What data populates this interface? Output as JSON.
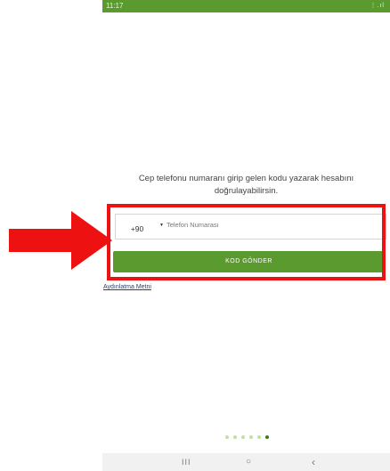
{
  "status_bar": {
    "time": "11:17",
    "icons": "⋮.ıl"
  },
  "instruction_text": "Cep telefonu numaranı girip gelen kodu yazarak hesabını doğrulayabilirsin.",
  "phone_form": {
    "country_code": "+90",
    "phone_placeholder": "Telefon Numarası",
    "phone_value": ""
  },
  "send_button_label": "KOD GÖNDER",
  "disclosure_link": "Aydınlatma Metni",
  "pagination": {
    "total": 6,
    "active_index": 5
  },
  "nav_bar": {
    "recents": "III",
    "home": "○",
    "back": "‹"
  },
  "colors": {
    "brand_green": "#5a9a2e",
    "highlight_red": "#ee1111",
    "active_dot": "#3f7a1e",
    "inactive_dot": "#bfe0a8"
  }
}
